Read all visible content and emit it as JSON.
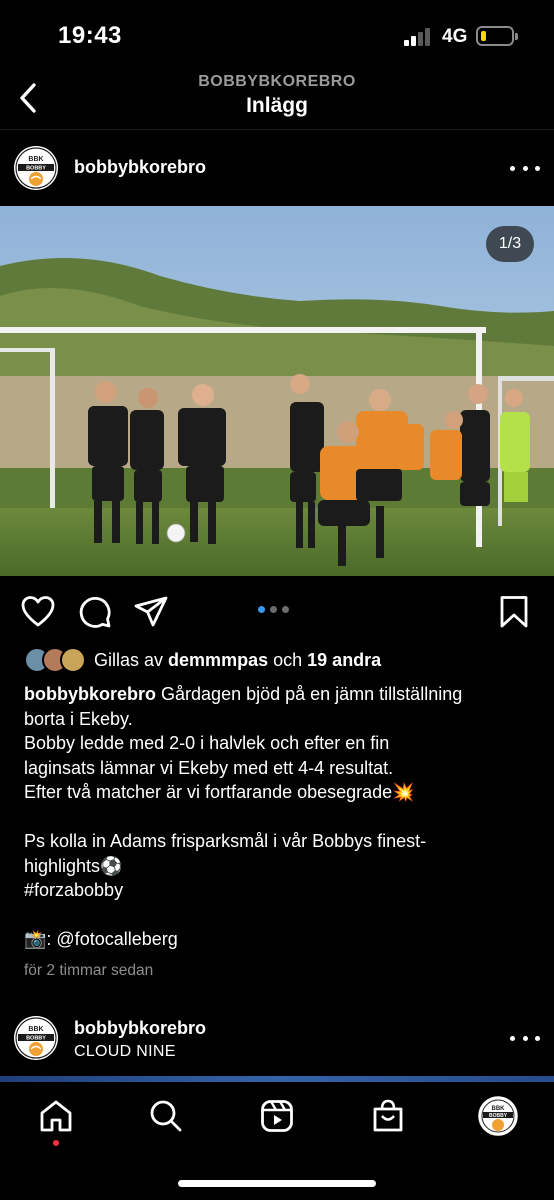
{
  "status_bar": {
    "time": "19:43",
    "network": "4G",
    "battery_level": 0.15,
    "battery_color": "#ffd60a"
  },
  "header": {
    "subtitle": "BOBBYBKOREBRO",
    "title": "Inlägg"
  },
  "post": {
    "username": "bobbybkorebro",
    "photo_counter": "1/3",
    "carousel": {
      "current": 1,
      "total": 3
    },
    "likes": {
      "prefix": "Gillas av",
      "user": "demmmpas",
      "connector": "och",
      "others": "19 andra"
    },
    "caption": {
      "username": "bobbybkorebro",
      "lines": [
        "Gårdagen bjöd på en jämn tillställning",
        "borta i Ekeby.",
        "Bobby ledde med 2-0 i halvlek och efter en fin",
        "laginsats lämnar vi Ekeby med ett 4-4 resultat.",
        "Efter två matcher är vi fortfarande obesegrade💥",
        "",
        "Ps kolla in Adams frisparksmål i vår Bobbys finest-",
        "highlights⚽️",
        "#forzabobby",
        "",
        "📸: @fotocalleberg"
      ]
    },
    "timestamp": "för 2 timmar sedan"
  },
  "next_post": {
    "username": "bobbybkorebro",
    "subtitle": "CLOUD NINE"
  },
  "colors": {
    "accent": "#3897f0",
    "notification": "#ff3040",
    "club_orange": "#f0a030"
  },
  "logo": {
    "top_text": "BBK",
    "band_text": "BOBBY"
  }
}
